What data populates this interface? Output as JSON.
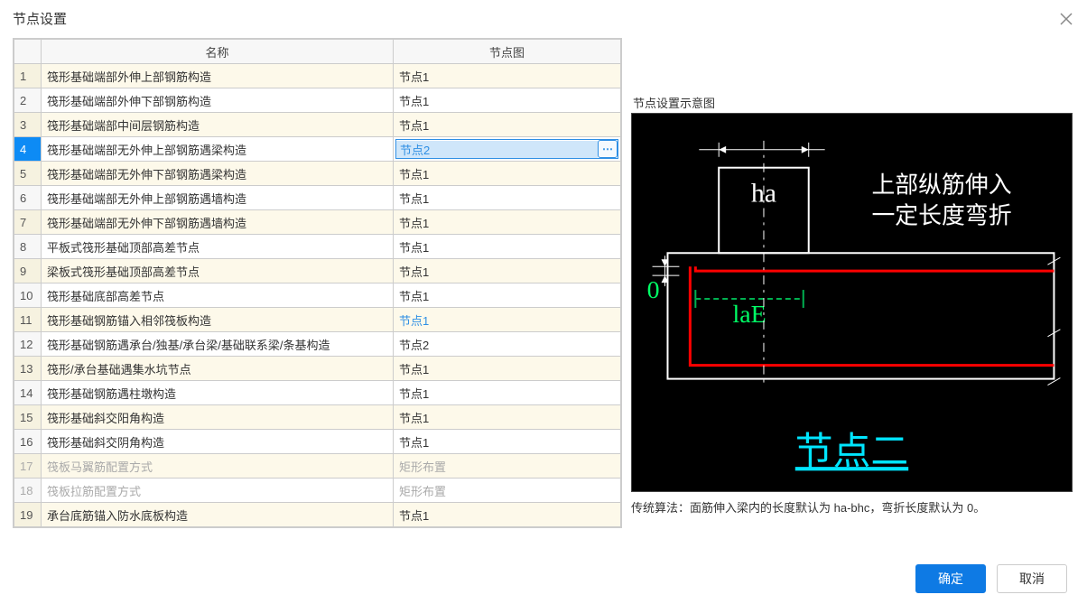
{
  "dialog": {
    "title": "节点设置",
    "close": "×"
  },
  "table": {
    "headers": {
      "name": "名称",
      "node": "节点图"
    },
    "ellipsis": "⋯",
    "rows": [
      {
        "no": "1",
        "name": "筏形基础端部外伸上部钢筋构造",
        "node": "节点1"
      },
      {
        "no": "2",
        "name": "筏形基础端部外伸下部钢筋构造",
        "node": "节点1"
      },
      {
        "no": "3",
        "name": "筏形基础端部中间层钢筋构造",
        "node": "节点1"
      },
      {
        "no": "4",
        "name": "筏形基础端部无外伸上部钢筋遇梁构造",
        "node": "节点2",
        "selected": true,
        "editing": true
      },
      {
        "no": "5",
        "name": "筏形基础端部无外伸下部钢筋遇梁构造",
        "node": "节点1"
      },
      {
        "no": "6",
        "name": "筏形基础端部无外伸上部钢筋遇墙构造",
        "node": "节点1"
      },
      {
        "no": "7",
        "name": "筏形基础端部无外伸下部钢筋遇墙构造",
        "node": "节点1"
      },
      {
        "no": "8",
        "name": "平板式筏形基础顶部高差节点",
        "node": "节点1"
      },
      {
        "no": "9",
        "name": "梁板式筏形基础顶部高差节点",
        "node": "节点1"
      },
      {
        "no": "10",
        "name": "筏形基础底部高差节点",
        "node": "节点1"
      },
      {
        "no": "11",
        "name": "筏形基础钢筋锚入相邻筏板构造",
        "node": "节点1",
        "blue": true
      },
      {
        "no": "12",
        "name": "筏形基础钢筋遇承台/独基/承台梁/基础联系梁/条基构造",
        "node": "节点2"
      },
      {
        "no": "13",
        "name": "筏形/承台基础遇集水坑节点",
        "node": "节点1"
      },
      {
        "no": "14",
        "name": "筏形基础钢筋遇柱墩构造",
        "node": "节点1"
      },
      {
        "no": "15",
        "name": "筏形基础斜交阳角构造",
        "node": "节点1"
      },
      {
        "no": "16",
        "name": "筏形基础斜交阴角构造",
        "node": "节点1"
      },
      {
        "no": "17",
        "name": "筏板马翼筋配置方式",
        "node": "矩形布置",
        "disabled": true
      },
      {
        "no": "18",
        "name": "筏板拉筋配置方式",
        "node": "矩形布置",
        "disabled": true
      },
      {
        "no": "19",
        "name": "承台底筋锚入防水底板构造",
        "node": "节点1"
      }
    ]
  },
  "diagram": {
    "panel_title": "节点设置示意图",
    "label_ha": "ha",
    "label_zero": "0",
    "label_laE": "laE",
    "text_line1": "上部纵筋伸入",
    "text_line2": "一定长度弯折",
    "caption": "节点二",
    "note": "传统算法：面筋伸入梁内的长度默认为 ha-bhc，弯折长度默认为 0。"
  },
  "footer": {
    "ok": "确定",
    "cancel": "取消"
  }
}
